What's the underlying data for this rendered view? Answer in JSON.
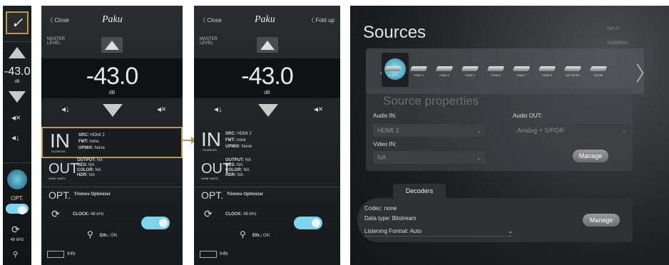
{
  "left_strip": {
    "volume": "43.0",
    "volume_sign": "-",
    "unit": "dB",
    "opt_label": "OPT.",
    "clock": "48 kHz"
  },
  "panel1": {
    "close": "Close",
    "brand": "Paku",
    "master_level": "MASTER\nLEVEL",
    "volume": "-43.0",
    "unit": "dB",
    "in_label": "IN",
    "in_sub": "SOURCES",
    "src_key": "SRC:",
    "src_val": "HDMI 2",
    "fmt_key": "FMT:",
    "fmt_val": "none",
    "upmix_key": "UPMIX:",
    "upmix_val": "None",
    "out_label": "OUT",
    "out_sub": "HDMI VIDEO",
    "output_key": "OUTPUT:",
    "output_val": "NA",
    "res_key": "RES:",
    "res_val": "NA",
    "color_key": "COLOR:",
    "color_val": "NA",
    "hdr_key": "HDR:",
    "hdr_val": "NA",
    "opt_label": "OPT.",
    "opt_name": "Trinnov Optimizer",
    "clock_key": "CLOCK:",
    "clock_val": "48 kHz",
    "eth_key": "Eth.:",
    "eth_val": "ON",
    "info": "Info"
  },
  "panel2": {
    "close": "Close",
    "fold": "Fold up",
    "brand": "Paku",
    "master_level": "MASTER\nLEVEL",
    "volume": "-43.0",
    "unit": "dB",
    "in_label": "IN",
    "in_sub": "SOURCES",
    "src_key": "SRC:",
    "src_val": "HDMI 2",
    "fmt_key": "FMT:",
    "fmt_val": "none",
    "upmix_key": "UPMIX:",
    "upmix_val": "None",
    "out_label": "OUT",
    "out_sub": "HDMI VIDEO",
    "output_key": "OUTPUT:",
    "output_val": "NA",
    "res_key": "RES:",
    "res_val": "NA",
    "color_key": "COLOR:",
    "color_val": "NA",
    "hdr_key": "HDR:",
    "hdr_val": "NA",
    "opt_label": "OPT.",
    "opt_name": "Trinnov Optimizer",
    "clock_key": "CLOCK:",
    "clock_val": "48 kHz",
    "eth_key": "Eth.:",
    "eth_val": "ON",
    "info": "Info"
  },
  "sources": {
    "title": "Sources",
    "items": [
      "HDMI 2",
      "HDMI 3",
      "HDMI 4",
      "HDMI 5",
      "HDMI 6",
      "HDMI 7",
      "HDMI 8",
      "NETWORK",
      "ROON"
    ],
    "props_title": "Source properties",
    "audio_in_label": "Audio IN:",
    "audio_in_val": "HDMI 2",
    "audio_out_label": "Audio OUT:",
    "audio_out_val": "Analog + S/PDIF",
    "video_in_label": "Video IN:",
    "video_in_val": "NA",
    "manage": "Manage",
    "decoders_tab": "Decoders",
    "codec": "Codec: none",
    "data_type": "Data type: Bitstream",
    "listening_label": "Listening Format:",
    "listening_val": "Auto",
    "manage2": "Manage",
    "rear_labels": [
      "INPUT",
      "SUBMENU"
    ]
  }
}
